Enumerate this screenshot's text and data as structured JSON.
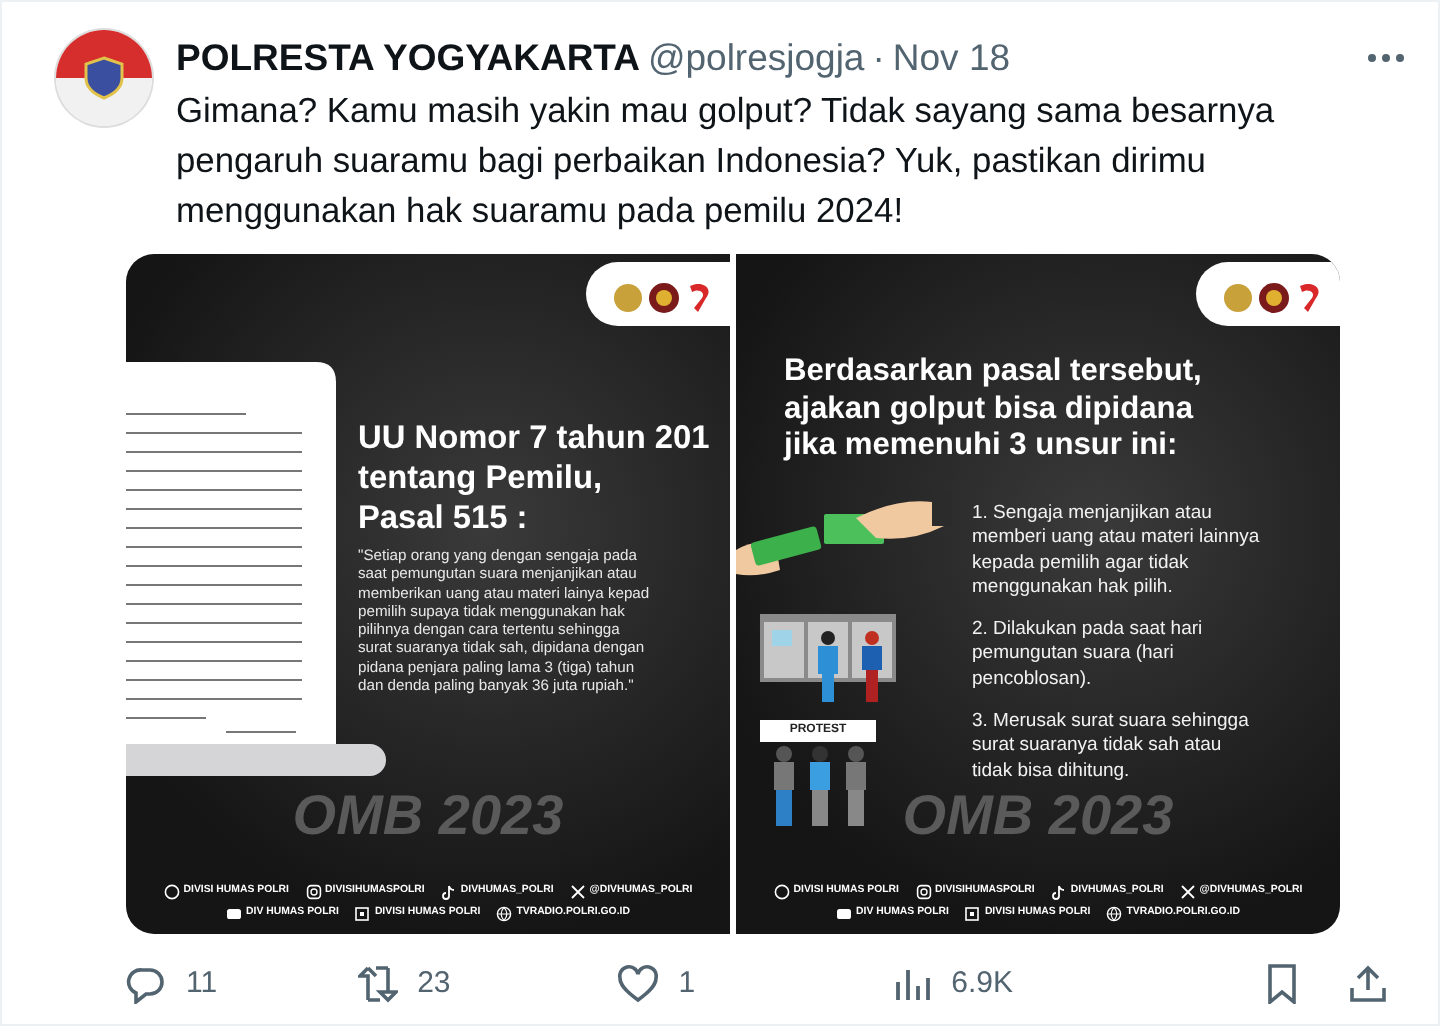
{
  "tweet": {
    "author": {
      "name": "POLRESTA YOGYAKARTA",
      "handle": "@polresjogja",
      "separator": "·",
      "date": "Nov 18"
    },
    "text": "Gimana? Kamu masih yakin mau golput? Tidak sayang sama besarnya pengaruh suaramu bagi perbaikan Indonesia?  Yuk, pastikan dirimu menggunakan hak suaramu pada pemilu 2024!",
    "media": [
      {
        "kind": "law",
        "title_lines": [
          "UU Nomor 7 tahun 201",
          "tentang Pemilu,",
          "Pasal 515 :"
        ],
        "quote_lines": [
          "\"Setiap orang yang dengan sengaja pada",
          "saat pemungutan suara menjanjikan atau",
          "memberikan uang atau materi lainya kepad",
          "pemilih supaya tidak menggunakan hak",
          "pilihnya dengan cara tertentu sehingga",
          "surat suaranya tidak sah, dipidana dengan",
          "pidana penjara paling lama 3 (tiga) tahun",
          "dan denda paling banyak 36 juta rupiah.\""
        ],
        "watermark": "OMB 2023",
        "footer": [
          [
            "DIVISI HUMAS POLRI",
            "DIVISIHUMASPOLRI",
            "DIVHUMAS_POLRI",
            "@DIVHUMAS_POLRI"
          ],
          [
            "DIV HUMAS POLRI",
            "DIVISI HUMAS POLRI",
            "TVRADIO.POLRI.GO.ID"
          ]
        ]
      },
      {
        "kind": "elements",
        "title_lines": [
          "Berdasarkan pasal tersebut,",
          "ajakan golput bisa dipidana",
          "jika memenuhi 3 unsur ini:"
        ],
        "items": [
          [
            "1. Sengaja menjanjikan atau",
            "memberi uang atau materi lainnya",
            "kepada pemilih agar tidak",
            "menggunakan hak pilih."
          ],
          [
            "2. Dilakukan pada saat hari",
            "pemungutan suara (hari",
            "pencoblosan)."
          ],
          [
            "3. Merusak surat suara sehingga",
            "surat suaranya tidak sah atau",
            "tidak bisa dihitung."
          ]
        ],
        "sign_text": "PROTEST",
        "watermark": "OMB 2023",
        "footer": [
          [
            "DIVISI HUMAS POLRI",
            "DIVISIHUMASPOLRI",
            "DIVHUMAS_POLRI",
            "@DIVHUMAS_POLRI"
          ],
          [
            "DIV HUMAS POLRI",
            "DIVISI HUMAS POLRI",
            "TVRADIO.POLRI.GO.ID"
          ]
        ]
      }
    ],
    "actions": {
      "replies": "11",
      "reposts": "23",
      "likes": "1",
      "views": "6.9K"
    }
  }
}
